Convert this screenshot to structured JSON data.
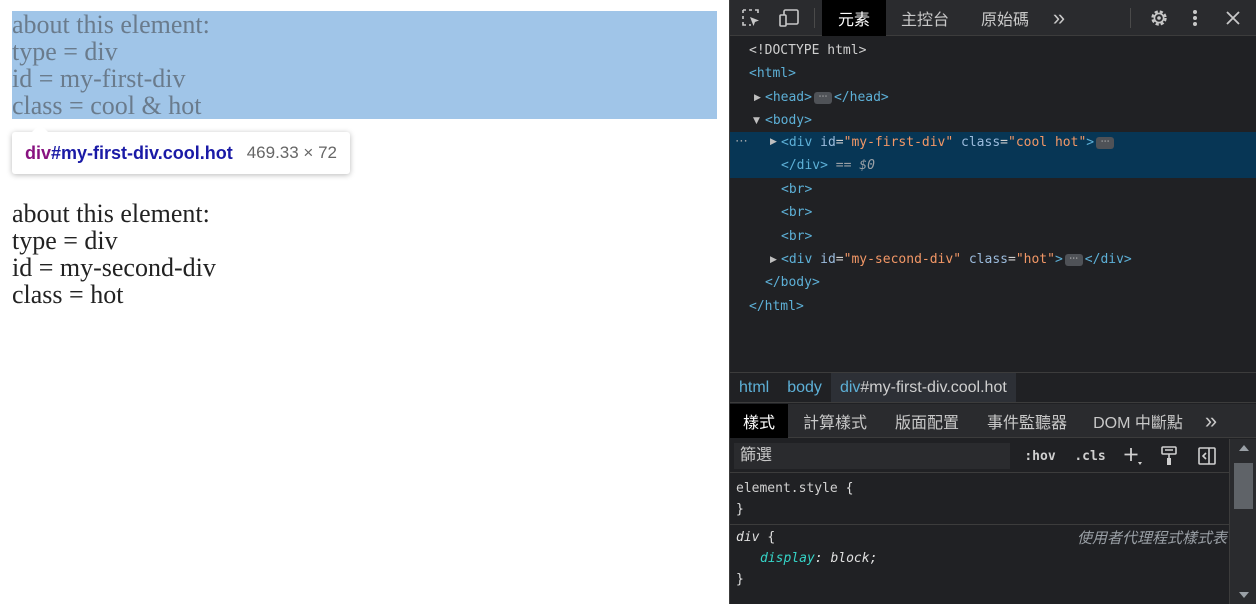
{
  "page": {
    "first_div": [
      "about this element:",
      "type = div",
      "id = my-first-div",
      "class = cool & hot"
    ],
    "second_div": [
      "about this element:",
      "type = div",
      "id = my-second-div",
      "class = hot"
    ],
    "tooltip": {
      "tag": "div",
      "selector": "#my-first-div.cool.hot",
      "size": "469.33 × 72"
    }
  },
  "devtools": {
    "main_tabs": [
      {
        "label": "元素",
        "active": true
      },
      {
        "label": "主控台",
        "active": false
      },
      {
        "label": "原始碼",
        "active": false
      }
    ],
    "more_tabs": "»",
    "dom": {
      "doctype": "<!DOCTYPE html>",
      "html_open": "<html>",
      "head_open": "<head>",
      "head_close": "</head>",
      "body_open": "<body>",
      "div1_open": "<div",
      "div1_id_attr": "id",
      "div1_id_val": "\"my-first-div\"",
      "div1_class_attr": "class",
      "div1_class_val": "\"cool hot\"",
      "gt": ">",
      "div1_close": "</div>",
      "eq_ref": "==",
      "ref_var": "$0",
      "br": "<br>",
      "div2_open": "<div",
      "div2_id_attr": "id",
      "div2_id_val": "\"my-second-div\"",
      "div2_class_attr": "class",
      "div2_class_val": "\"hot\"",
      "div2_close": "</div>",
      "body_close": "</body>",
      "html_close": "</html>",
      "ellipsis": "⋯",
      "gutter": "⋯"
    },
    "breadcrumb": {
      "html": "html",
      "body": "body",
      "div_tag": "div",
      "div_rest": "#my-first-div.cool.hot"
    },
    "style_tabs": [
      {
        "label": "樣式",
        "active": true
      },
      {
        "label": "計算樣式",
        "active": false
      },
      {
        "label": "版面配置",
        "active": false
      },
      {
        "label": "事件監聽器",
        "active": false
      },
      {
        "label": "DOM 中斷點",
        "active": false
      }
    ],
    "filter": {
      "placeholder": "篩選",
      "hov": ":hov",
      "cls": ".cls"
    },
    "rules": {
      "element_style": "element.style",
      "open_brace": "{",
      "close_brace": "}",
      "div_selector": "div",
      "source": "使用者代理程式樣式表",
      "prop": "display",
      "colon": ":",
      "value": "block",
      "semicolon": ";"
    }
  }
}
